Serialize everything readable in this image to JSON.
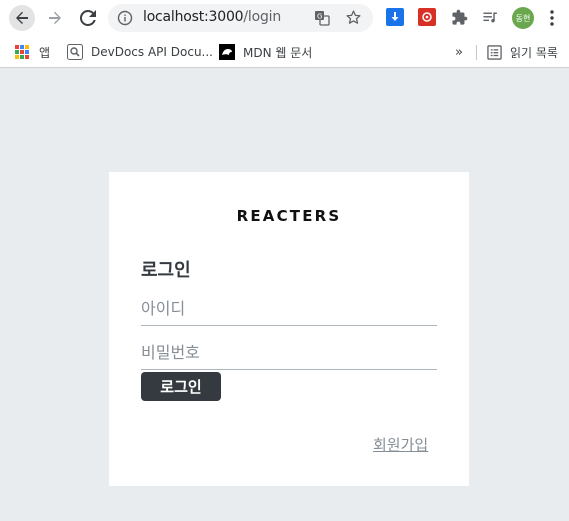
{
  "browser": {
    "url_host": "localhost:3000",
    "url_path": "/login",
    "profile_label": "동현",
    "bookmarks": {
      "apps_label": "앱",
      "devdocs_label": "DevDocs API Docu...",
      "mdn_label": "MDN 웹 문서",
      "more_label": "»",
      "reading_list_label": "읽기 목록"
    },
    "colors": {
      "profile": "#6aa84f",
      "download_ext": "#1a73e8",
      "red_ext": "#d93025"
    }
  },
  "login": {
    "logo": "REACTERS",
    "heading": "로그인",
    "id_placeholder": "아이디",
    "password_placeholder": "비밀번호",
    "submit_label": "로그인",
    "register_link": "회원가입",
    "colors": {
      "page_bg": "#e9ecef",
      "button": "#343a40"
    }
  },
  "icons": [
    "back-arrow-icon",
    "forward-arrow-icon",
    "reload-icon",
    "info-icon",
    "translate-icon",
    "star-icon",
    "download-icon",
    "extension-icon",
    "puzzle-icon",
    "media-icon",
    "kebab-menu-icon",
    "apps-grid-icon",
    "devdocs-icon",
    "mdn-icon",
    "reading-list-icon"
  ]
}
